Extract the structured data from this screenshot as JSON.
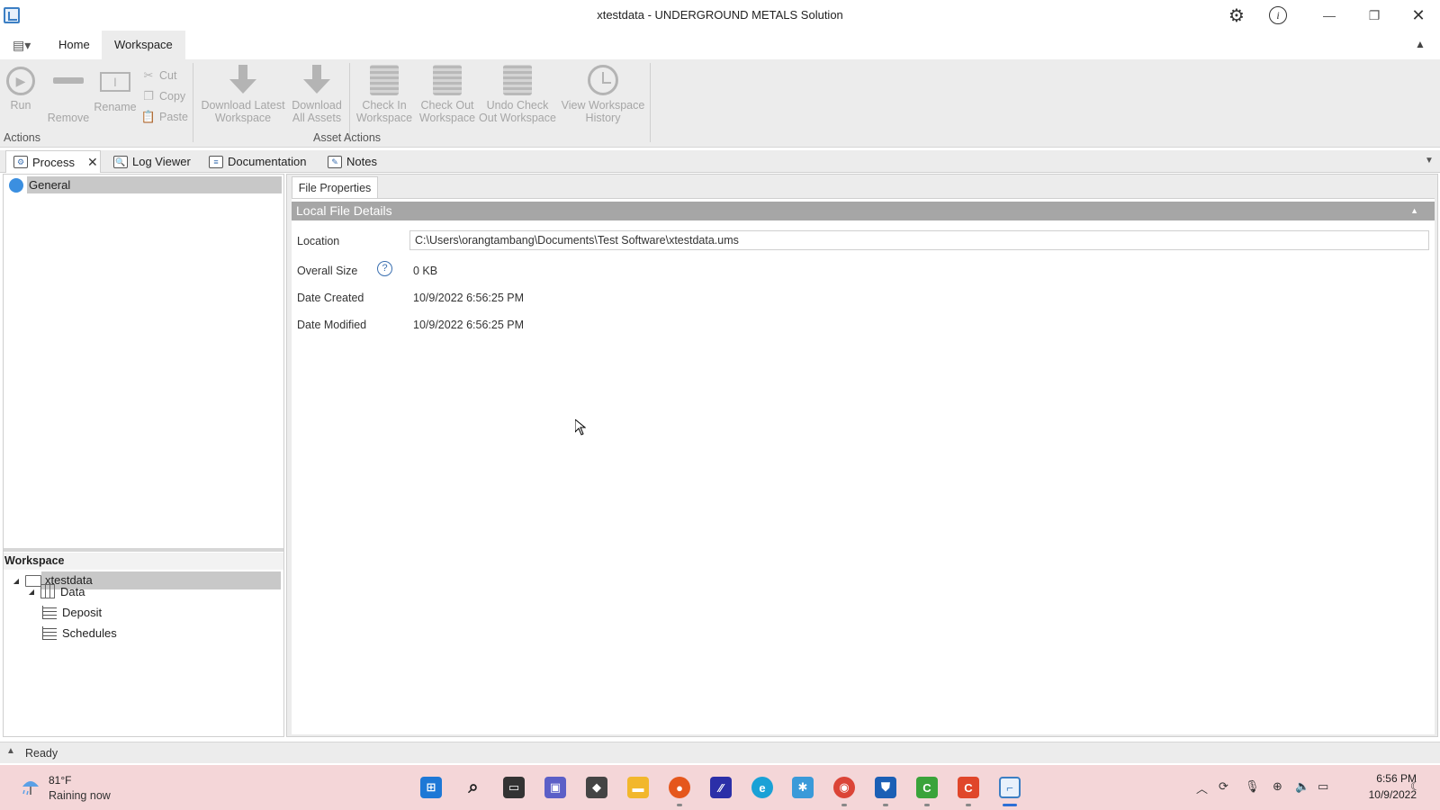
{
  "window": {
    "title": "xtestdata - UNDERGROUND METALS Solution"
  },
  "ribbon_tabs": {
    "home": "Home",
    "workspace": "Workspace"
  },
  "ribbon": {
    "run": "Run",
    "remove": "Remove",
    "rename": "Rename",
    "cut": "Cut",
    "copy": "Copy",
    "paste": "Paste",
    "download_latest_1": "Download Latest",
    "download_latest_2": "Workspace",
    "download_all_1": "Download",
    "download_all_2": "All Assets",
    "check_in_1": "Check In",
    "check_in_2": "Workspace",
    "check_out_1": "Check Out",
    "check_out_2": "Workspace",
    "undo_check_1": "Undo Check",
    "undo_check_2": "Out Workspace",
    "history_1": "View Workspace",
    "history_2": "History",
    "group_actions": "Actions",
    "group_asset_actions": "Asset Actions"
  },
  "doc_tabs": {
    "process": "Process",
    "log_viewer": "Log Viewer",
    "documentation": "Documentation",
    "notes": "Notes"
  },
  "left_panel": {
    "general": "General",
    "workspace_header": "Workspace",
    "tree": {
      "root": "xtestdata",
      "data": "Data",
      "deposit": "Deposit",
      "schedules": "Schedules"
    }
  },
  "right_panel": {
    "tab": "File Properties",
    "section": "Local File Details",
    "location_label": "Location",
    "location_value": "C:\\Users\\orangtambang\\Documents\\Test Software\\xtestdata.ums",
    "size_label": "Overall Size",
    "size_value": "0 KB",
    "created_label": "Date Created",
    "created_value": "10/9/2022 6:56:25 PM",
    "modified_label": "Date Modified",
    "modified_value": "10/9/2022 6:56:25 PM"
  },
  "status": {
    "text": "Ready"
  },
  "taskbar": {
    "weather_temp": "81°F",
    "weather_desc": "Raining now",
    "time": "6:56 PM",
    "date": "10/9/2022"
  }
}
